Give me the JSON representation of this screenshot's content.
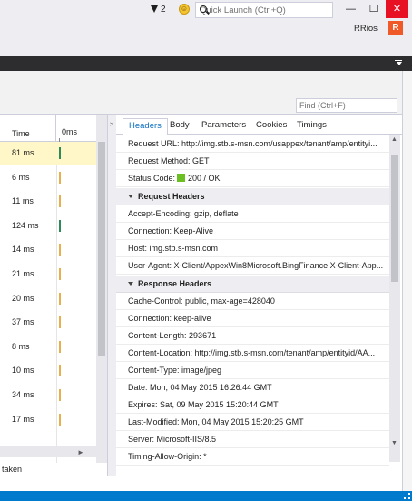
{
  "title_bar": {
    "notification_count": "2",
    "quick_launch_placeholder": "Quick Launch (Ctrl+Q)",
    "user_name": "RRios",
    "avatar_letter": "R",
    "minimize": "—",
    "maximize": "☐",
    "close": "✕"
  },
  "find": {
    "placeholder": "Find (Ctrl+F)"
  },
  "left_table": {
    "columns": [
      "Time",
      "0ms"
    ],
    "rows": [
      {
        "time": "81 ms",
        "color": "#2e8b57",
        "selected": true
      },
      {
        "time": "6 ms",
        "color": "#e8b04a"
      },
      {
        "time": "11 ms",
        "color": "#e8b04a"
      },
      {
        "time": "124 ms",
        "color": "#2e8b57"
      },
      {
        "time": "14 ms",
        "color": "#e8b04a"
      },
      {
        "time": "21 ms",
        "color": "#e8b04a"
      },
      {
        "time": "20 ms",
        "color": "#e8b04a"
      },
      {
        "time": "37 ms",
        "color": "#e8b04a"
      },
      {
        "time": "8 ms",
        "color": "#e8b04a"
      },
      {
        "time": "10 ms",
        "color": "#e8b04a"
      },
      {
        "time": "34 ms",
        "color": "#e8b04a"
      },
      {
        "time": "17 ms",
        "color": "#e8b04a"
      }
    ],
    "status_text": "taken"
  },
  "details": {
    "tabs": [
      "Headers",
      "Body",
      "Parameters",
      "Cookies",
      "Timings"
    ],
    "active_tab": "Headers",
    "general": {
      "request_url": "Request URL: http://img.stb.s-msn.com/usappex/tenant/amp/entityi...",
      "request_method": "Request Method: GET",
      "status_code_label": "Status Code:",
      "status_code_value": "200 / OK"
    },
    "request_headers_title": "Request Headers",
    "request_headers": [
      "Accept-Encoding: gzip, deflate",
      "Connection: Keep-Alive",
      "Host: img.stb.s-msn.com",
      "User-Agent: X-Client/AppexWin8Microsoft.BingFinance X-Client-App..."
    ],
    "response_headers_title": "Response Headers",
    "response_headers": [
      "Cache-Control: public, max-age=428040",
      "Connection: keep-alive",
      "Content-Length: 293671",
      "Content-Location: http://img.stb.s-msn.com/tenant/amp/entityid/AA...",
      "Content-Type: image/jpeg",
      "Date: Mon, 04 May 2015 16:26:44 GMT",
      "Expires: Sat, 09 May 2015 15:20:44 GMT",
      "Last-Modified: Mon, 04 May 2015 15:20:25 GMT",
      "Server: Microsoft-IIS/8.5",
      "Timing-Allow-Origin: *"
    ]
  }
}
